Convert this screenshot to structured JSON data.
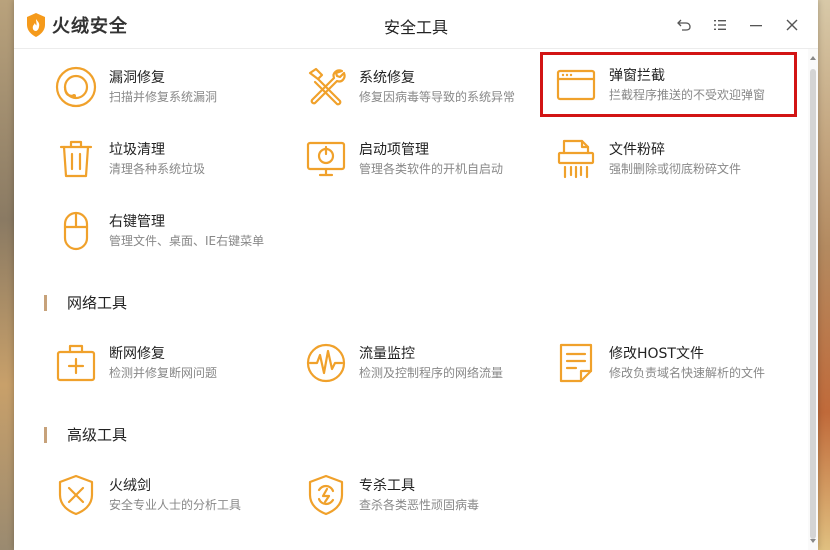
{
  "app": {
    "brand": "火绒安全",
    "window_title": "安全工具"
  },
  "sections": {
    "system": {
      "items": [
        {
          "name": "漏洞修复",
          "desc": "扫描并修复系统漏洞",
          "icon": "vulnerability-fix-icon"
        },
        {
          "name": "系统修复",
          "desc": "修复因病毒等导致的系统异常",
          "icon": "system-repair-icon"
        },
        {
          "name": "弹窗拦截",
          "desc": "拦截程序推送的不受欢迎弹窗",
          "icon": "popup-block-icon"
        },
        {
          "name": "垃圾清理",
          "desc": "清理各种系统垃圾",
          "icon": "trash-icon"
        },
        {
          "name": "启动项管理",
          "desc": "管理各类软件的开机自启动",
          "icon": "startup-monitor-icon"
        },
        {
          "name": "文件粉碎",
          "desc": "强制删除或彻底粉碎文件",
          "icon": "shredder-icon"
        },
        {
          "name": "右键管理",
          "desc": "管理文件、桌面、IE右键菜单",
          "icon": "mouse-icon"
        }
      ]
    },
    "network": {
      "title": "网络工具",
      "items": [
        {
          "name": "断网修复",
          "desc": "检测并修复断网问题",
          "icon": "medkit-icon"
        },
        {
          "name": "流量监控",
          "desc": "检测及控制程序的网络流量",
          "icon": "traffic-monitor-icon"
        },
        {
          "name": "修改HOST文件",
          "desc": "修改负责域名快速解析的文件",
          "icon": "host-file-icon"
        }
      ]
    },
    "advanced": {
      "title": "高级工具",
      "items": [
        {
          "name": "火绒剑",
          "desc": "安全专业人士的分析工具",
          "icon": "sword-shield-icon"
        },
        {
          "name": "专杀工具",
          "desc": "查杀各类恶性顽固病毒",
          "icon": "virus-kill-shield-icon"
        }
      ]
    }
  },
  "colors": {
    "accent": "#f0a12b",
    "highlight_border": "#d21414",
    "section_bar": "#c7a27a"
  }
}
